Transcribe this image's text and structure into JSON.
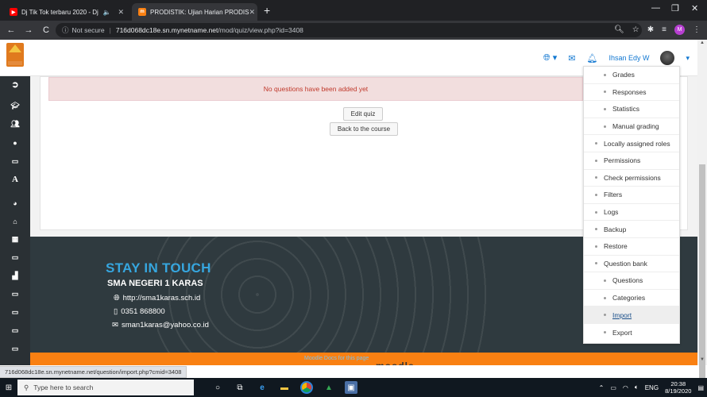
{
  "browser": {
    "tabs": [
      {
        "title": "Dj Tik Tok terbaru 2020 - Dj",
        "favicon": "youtube-icon",
        "active": false
      },
      {
        "title": "PRODISTIK: Ujian Harian PRODIS",
        "favicon": "moodle-icon",
        "active": true
      }
    ],
    "new_tab": "+",
    "security": "Not secure",
    "url_host": "716d068dc18e.sn.mynetname.net",
    "url_path": "/mod/quiz/view.php?id=3408",
    "profile_initial": "M"
  },
  "navbar": {
    "user_name": "Ihsan Edy W"
  },
  "main": {
    "alert_text": "No questions have been added yet",
    "edit_quiz_label": "Edit quiz",
    "back_label": "Back to the course"
  },
  "admin_menu": {
    "items": [
      {
        "label": "Grades",
        "level": 2
      },
      {
        "label": "Responses",
        "level": 2
      },
      {
        "label": "Statistics",
        "level": 2
      },
      {
        "label": "Manual grading",
        "level": 2
      },
      {
        "label": "Locally assigned roles",
        "level": 1
      },
      {
        "label": "Permissions",
        "level": 1
      },
      {
        "label": "Check permissions",
        "level": 1
      },
      {
        "label": "Filters",
        "level": 1
      },
      {
        "label": "Logs",
        "level": 1
      },
      {
        "label": "Backup",
        "level": 1
      },
      {
        "label": "Restore",
        "level": 1
      },
      {
        "label": "Question bank",
        "level": 1
      },
      {
        "label": "Questions",
        "level": 2
      },
      {
        "label": "Categories",
        "level": 2
      },
      {
        "label": "Import",
        "level": 2,
        "hover": true
      },
      {
        "label": "Export",
        "level": 2
      }
    ]
  },
  "footer": {
    "heading": "STAY IN TOUCH",
    "school": "SMA NEGERI 1 KARAS",
    "website": "http://sma1karas.sch.id",
    "phone": "0351 868800",
    "email": "sman1karas@yahoo.co.id",
    "docs_link": "Moodle Docs for this page",
    "moodle_logo_text": "moodle"
  },
  "status_url": "716d068dc18e.sn.mynetname.net/question/import.php?cmid=3408",
  "taskbar": {
    "search_placeholder": "Type here to search",
    "language": "ENG",
    "time": "20:38",
    "date": "8/19/2020"
  },
  "colors": {
    "footer_bg": "#2f3a3f",
    "footer_heading": "#36a6df",
    "moodle_orange": "#f98012",
    "alert_bg": "#f2dede",
    "alert_text": "#c0392b",
    "link_blue": "#1177d1"
  }
}
